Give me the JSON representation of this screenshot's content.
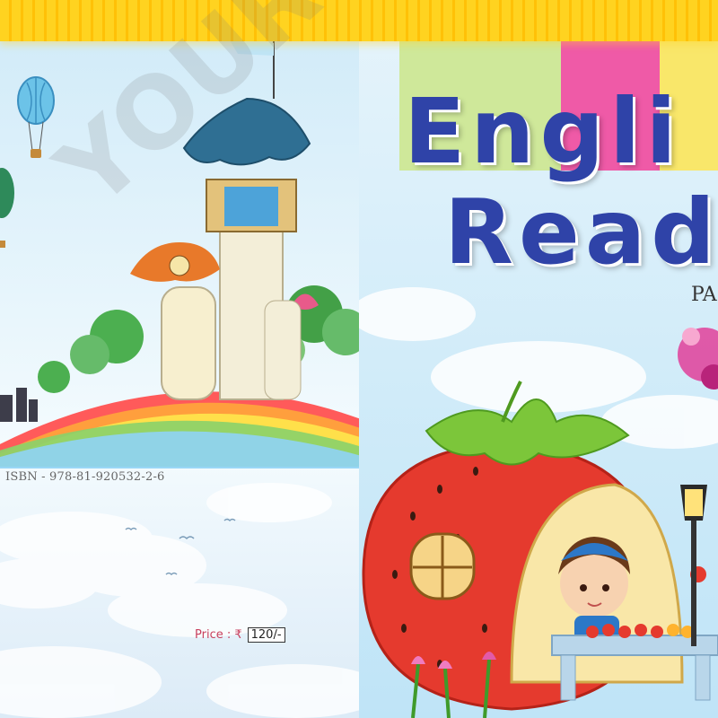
{
  "back_cover": {
    "isbn": "ISBN - 978-81-920532-2-6",
    "price_label": "Price : ₹",
    "price_value": "120/-"
  },
  "front_cover": {
    "title_line1": "Engli",
    "title_line2": "Read",
    "part_label": "PA"
  },
  "watermark": "YOUR ABC",
  "colors": {
    "title_blue": "#2f43a8",
    "top_bar_yellow": "#ffd320",
    "price_text": "#c8405e",
    "strawberry_red": "#e53a2e"
  }
}
